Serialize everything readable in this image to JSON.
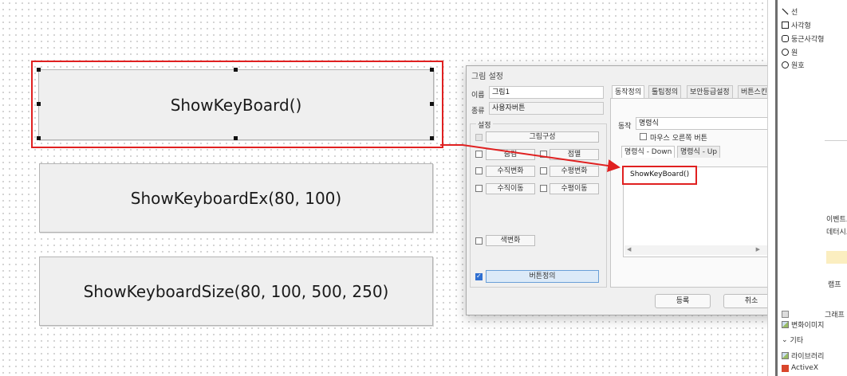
{
  "canvas": {
    "buttons": [
      {
        "label": "ShowKeyBoard()"
      },
      {
        "label": "ShowKeyboardEx(80, 100)"
      },
      {
        "label": "ShowKeyboardSize(80, 100, 500, 250)"
      }
    ]
  },
  "dialog": {
    "title": "그림 설정",
    "close": "×",
    "name_label": "이름",
    "name_value": "그림1",
    "type_label": "종류",
    "type_value": "사용자버튼",
    "settings_label": "설정",
    "options": {
      "compose": "그림구성",
      "blink": "점멸",
      "hidden": "숨김",
      "vchange": "수직변화",
      "hchange": "수평변화",
      "vmove": "수직이동",
      "hmove": "수평이동",
      "color": "색변화",
      "button_def": "버튼정의"
    },
    "tabs": [
      "동작정의",
      "툴팁정의",
      "보안등급설정",
      "버튼스킨"
    ],
    "action_label": "동작",
    "action_value": "명령식",
    "right_button_label": "마우스 오른쪽 버튼",
    "subtabs": [
      "명령식 - Down",
      "명령식 - Up"
    ],
    "command_text": "ShowKeyBoard()",
    "fx_label": "fx",
    "ok": "등록",
    "cancel": "취소"
  },
  "palette": {
    "items": [
      "선",
      "사각형",
      "둥근사각형",
      "원",
      "원호"
    ],
    "partials": [
      "이벤트트",
      "데터시트",
      "램프",
      "그래프"
    ],
    "image_item": "변화이미지",
    "section": "기타",
    "library": "라이브러리",
    "activex": "ActiveX"
  },
  "colors": {
    "highlight": "#e02020",
    "accent": "#2f6fd1"
  }
}
